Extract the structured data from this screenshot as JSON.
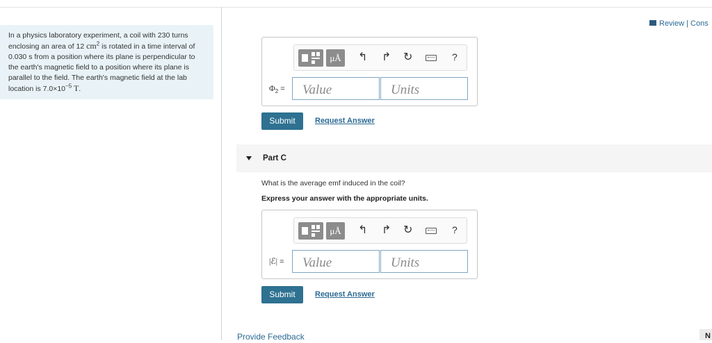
{
  "review": {
    "label": "Review | Cons"
  },
  "problem": {
    "text_1": "In a physics laboratory experiment, a coil with 230 turns enclosing an area of 12 ",
    "area_unit": "cm",
    "area_exp": "2",
    "text_2": " is rotated in a time interval of 0.030 s from a position where its plane is perpendicular to the earth's magnetic field to a position where its plane is parallel to the field. The earth's magnetic field at the lab location is 7.0×10",
    "field_exp": "−5",
    "field_unit": " T",
    "text_end": "."
  },
  "toolbar": {
    "templates_icon": "templates-icon",
    "units_label": "μÅ",
    "undo_icon": "undo-icon",
    "redo_icon": "redo-icon",
    "reset_icon": "reset-icon",
    "keyboard_icon": "keyboard-icon",
    "help_label": "?"
  },
  "partb": {
    "var_symbol": "Φ",
    "var_sub": "2",
    "equals": " =",
    "value_placeholder": "Value",
    "units_placeholder": "Units",
    "submit_label": "Submit",
    "request_label": "Request Answer"
  },
  "partc": {
    "label": "Part C",
    "question": "What is the average emf induced in the coil?",
    "instruction": "Express your answer with the appropriate units.",
    "var_symbol": "|ℰ|",
    "equals": " =",
    "value_placeholder": "Value",
    "units_placeholder": "Units",
    "submit_label": "Submit",
    "request_label": "Request Answer"
  },
  "footer": {
    "feedback_label": "Provide Feedback",
    "next_label": "N"
  },
  "colors": {
    "accent": "#2e7191",
    "link": "#2c6a93",
    "problem_bg": "#e9f3f7"
  }
}
